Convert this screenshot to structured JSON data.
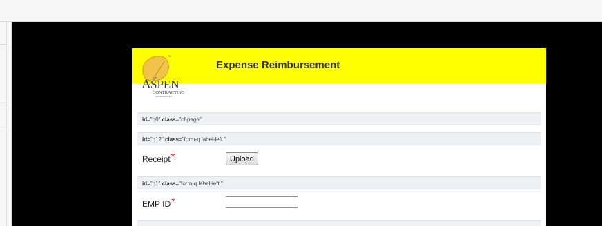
{
  "form": {
    "title": "Expense Reimbursement",
    "logo": {
      "name": "SPEN",
      "initial": "A",
      "subtitle": "CONTRACTING",
      "tagline": "INCORPORATED",
      "trademark": "™"
    },
    "page_bar": {
      "id_key": "id",
      "id_value": "=\"q0\"",
      "class_key": "class",
      "class_value": "=\"cf-page\""
    },
    "receipt_bar": {
      "id_key": "id",
      "id_value": "=\"q12\"",
      "class_key": "class",
      "class_value": "=\"form-q label-left \""
    },
    "receipt": {
      "label": "Receipt",
      "required_mark": "*",
      "button_label": "Upload"
    },
    "emp_bar": {
      "id_key": "id",
      "id_value": "=\"q1\"",
      "class_key": "class",
      "class_value": "=\"form-q label-left \""
    },
    "emp": {
      "label": "EMP ID",
      "required_mark": "*",
      "value": ""
    }
  }
}
